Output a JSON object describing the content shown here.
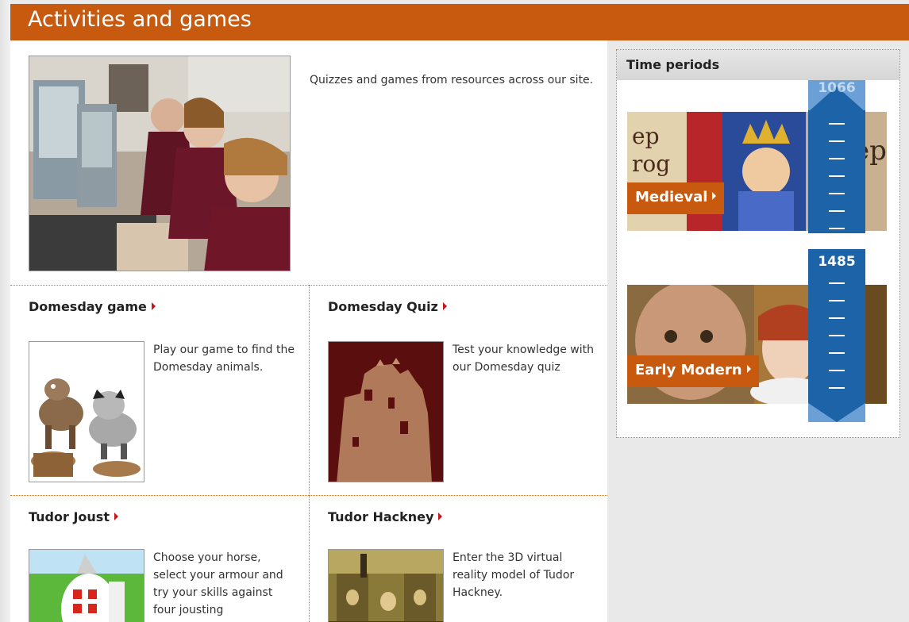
{
  "page": {
    "title": "Activities and games",
    "intro_text": "Quizzes and games from resources across our site."
  },
  "cards": [
    {
      "title": "Domesday game",
      "text": "Play our game to find the Domesday animals."
    },
    {
      "title": "Domesday Quiz",
      "text": "Test your knowledge with our Domesday quiz"
    },
    {
      "title": "Tudor Joust",
      "text": "Choose your horse, select your armour and try your skills against four jousting"
    },
    {
      "title": "Tudor Hackney",
      "text": "Enter the 3D virtual reality model of Tudor Hackney."
    }
  ],
  "sidebar": {
    "heading": "Time periods",
    "periods": [
      {
        "label": "Medieval"
      },
      {
        "label": "Early Modern"
      }
    ],
    "timeline": {
      "year_top": "1066",
      "year_middle": "1485"
    }
  },
  "colors": {
    "accent_orange": "#c85a0f",
    "timeline_blue": "#1d63a8",
    "arrow_red": "#c8161d"
  }
}
